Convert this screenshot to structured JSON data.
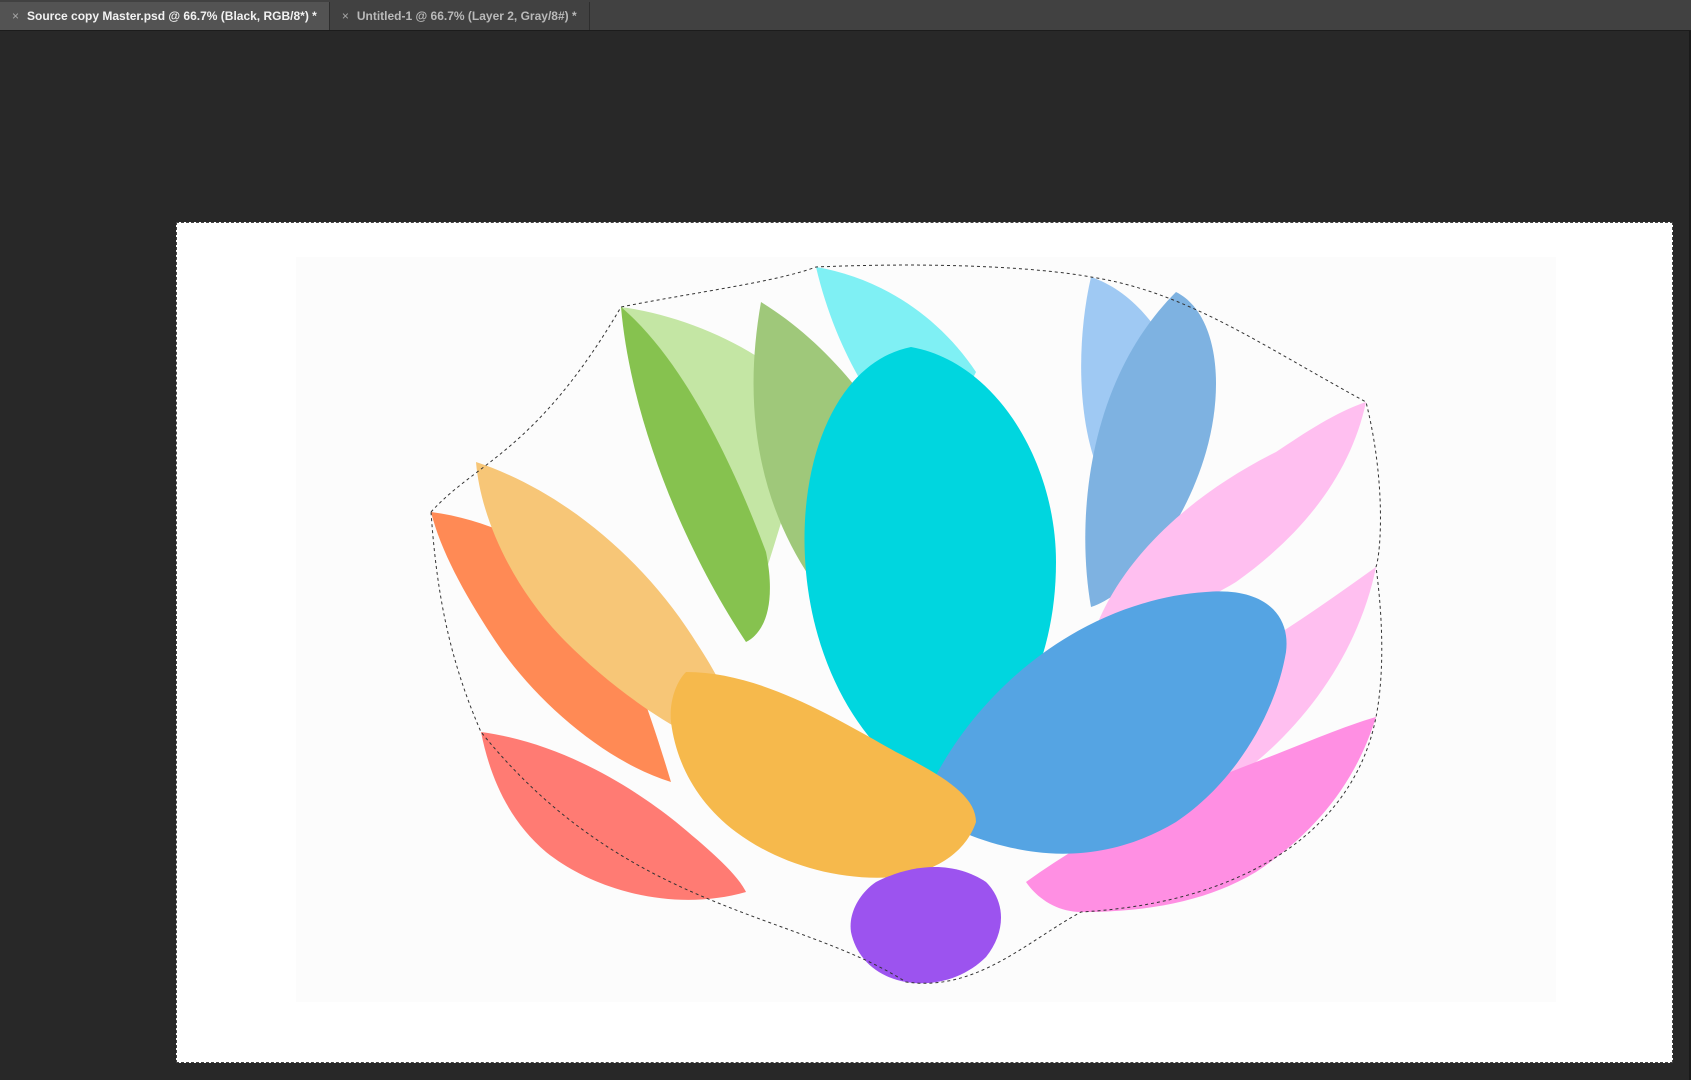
{
  "app": {
    "colors": {
      "tabbar": "#414141",
      "tab_active": "#535353",
      "workspace": "#282828",
      "canvas": "#ffffff"
    }
  },
  "tabs": [
    {
      "label": "Source copy Master.psd @ 66.7% (Black, RGB/8*) *",
      "close_icon": "×",
      "active": true
    },
    {
      "label": "Untitled-1 @ 66.7% (Layer 2, Gray/8#) *",
      "close_icon": "×",
      "active": false
    }
  ],
  "canvas": {
    "content": "lotus-flower-artwork",
    "petal_colors": {
      "green_light": "#c4e6a4",
      "green_dark": "#86c24f",
      "green_mid": "#9fc87a",
      "cyan_light": "#7ff0f4",
      "cyan_center": "#00d6df",
      "blue_light": "#9fc9f3",
      "blue_mid": "#7eb2e1",
      "orange": "#ff8a55",
      "orange_light": "#f7c677",
      "yellow": "#f6b94c",
      "salmon": "#ff7b73",
      "pink_light": "#ffbff0",
      "pink": "#ff8fe3",
      "blue": "#55a4e3",
      "purple": "#9c53ef"
    }
  }
}
